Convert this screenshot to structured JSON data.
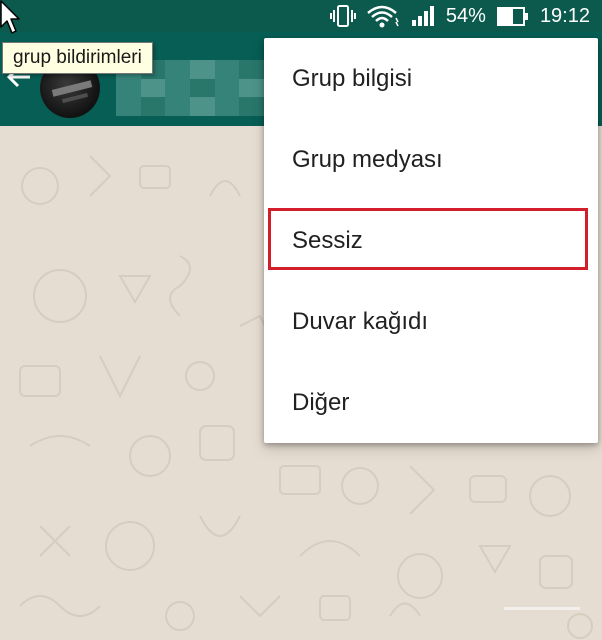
{
  "status_bar": {
    "battery": "54%",
    "time": "19:12",
    "icons": [
      "vibrate-icon",
      "wifi-icon",
      "signal-icon",
      "battery-icon"
    ]
  },
  "tooltip": {
    "text": "grup bildirimleri"
  },
  "menu": {
    "items": [
      {
        "label": "Grup bilgisi"
      },
      {
        "label": "Grup medyası"
      },
      {
        "label": "Sessiz",
        "highlighted": true
      },
      {
        "label": "Duvar kağıdı"
      },
      {
        "label": "Diğer"
      }
    ]
  },
  "colors": {
    "app_bar": "#075e54",
    "status_bar": "#0c594d",
    "chat_background": "#e6ddd2",
    "highlight_border": "#d21f2b"
  }
}
